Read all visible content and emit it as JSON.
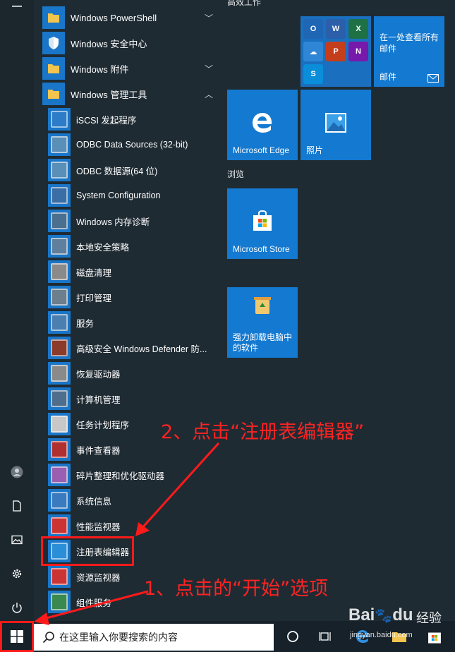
{
  "header": {
    "partial_group_title": "高效工作"
  },
  "folders": [
    {
      "label": "Windows PowerShell",
      "chevron": "﹀"
    },
    {
      "label": "Windows 安全中心",
      "chevron": ""
    },
    {
      "label": "Windows 附件",
      "chevron": "﹀"
    },
    {
      "label": "Windows 管理工具",
      "chevron": "︿"
    }
  ],
  "apps": [
    {
      "label": "iSCSI 发起程序",
      "icon": "globe-icon",
      "color": "#2c7cc7"
    },
    {
      "label": "ODBC Data Sources (32-bit)",
      "icon": "database-icon",
      "color": "#5a8fb8"
    },
    {
      "label": "ODBC 数据源(64 位)",
      "icon": "database-icon",
      "color": "#5a8fb8"
    },
    {
      "label": "System Configuration",
      "icon": "settings-window-icon",
      "color": "#3a6ea5"
    },
    {
      "label": "Windows 内存诊断",
      "icon": "memory-chip-icon",
      "color": "#4b6f8f"
    },
    {
      "label": "本地安全策略",
      "icon": "security-policy-icon",
      "color": "#5f7f9c"
    },
    {
      "label": "磁盘清理",
      "icon": "disk-cleanup-icon",
      "color": "#8a8a8a"
    },
    {
      "label": "打印管理",
      "icon": "printer-icon",
      "color": "#6d7f8c"
    },
    {
      "label": "服务",
      "icon": "gears-icon",
      "color": "#4a7fb0"
    },
    {
      "label": "高级安全 Windows Defender 防...",
      "icon": "firewall-icon",
      "color": "#8c3b2a"
    },
    {
      "label": "恢复驱动器",
      "icon": "drive-icon",
      "color": "#8a8a8a"
    },
    {
      "label": "计算机管理",
      "icon": "computer-management-icon",
      "color": "#4f6e8c"
    },
    {
      "label": "任务计划程序",
      "icon": "clock-icon",
      "color": "#c8c8c8"
    },
    {
      "label": "事件查看器",
      "icon": "event-viewer-icon",
      "color": "#b03030"
    },
    {
      "label": "碎片整理和优化驱动器",
      "icon": "defrag-icon",
      "color": "#9a5fb0"
    },
    {
      "label": "系统信息",
      "icon": "system-info-icon",
      "color": "#3a7abf"
    },
    {
      "label": "性能监视器",
      "icon": "performance-icon",
      "color": "#cc3333"
    },
    {
      "label": "注册表编辑器",
      "icon": "registry-editor-icon",
      "color": "#2a8fd6"
    },
    {
      "label": "资源监视器",
      "icon": "resource-monitor-icon",
      "color": "#cc3333"
    },
    {
      "label": "组件服务",
      "icon": "component-services-icon",
      "color": "#3a8a50"
    }
  ],
  "tiles": {
    "mail": {
      "label_line1": "在一处查看所有",
      "label_line2": "邮件",
      "footer": "邮件"
    },
    "edge": {
      "label": "Microsoft Edge"
    },
    "photos": {
      "label": "照片"
    },
    "browse_group": "浏览",
    "store": {
      "label": "Microsoft Store"
    },
    "uninstaller": {
      "label_line1": "强力卸载电脑中",
      "label_line2": "的软件"
    },
    "office_minis": [
      {
        "letter": "O",
        "color": "#1f66b5"
      },
      {
        "letter": "W",
        "color": "#2b5faa"
      },
      {
        "letter": "X",
        "color": "#1e7145"
      },
      {
        "letter": "☁",
        "color": "#2f86d6"
      },
      {
        "letter": "P",
        "color": "#c43e1c"
      },
      {
        "letter": "N",
        "color": "#7719aa"
      },
      {
        "letter": "S",
        "color": "#0a8ed9"
      }
    ]
  },
  "search": {
    "placeholder": "在这里输入你要搜索的内容"
  },
  "annotations": {
    "step2": "2、点击“注册表编辑器”",
    "step1": "1、点击的“开始”选项"
  },
  "watermark": {
    "brand": "Bai",
    "paw": "du",
    "cn": "经验",
    "url": "jingyan.baidu.com"
  },
  "colors": {
    "tile": "#1479d0",
    "accent_red": "#ff1a1a",
    "background": "#1f2b33"
  }
}
